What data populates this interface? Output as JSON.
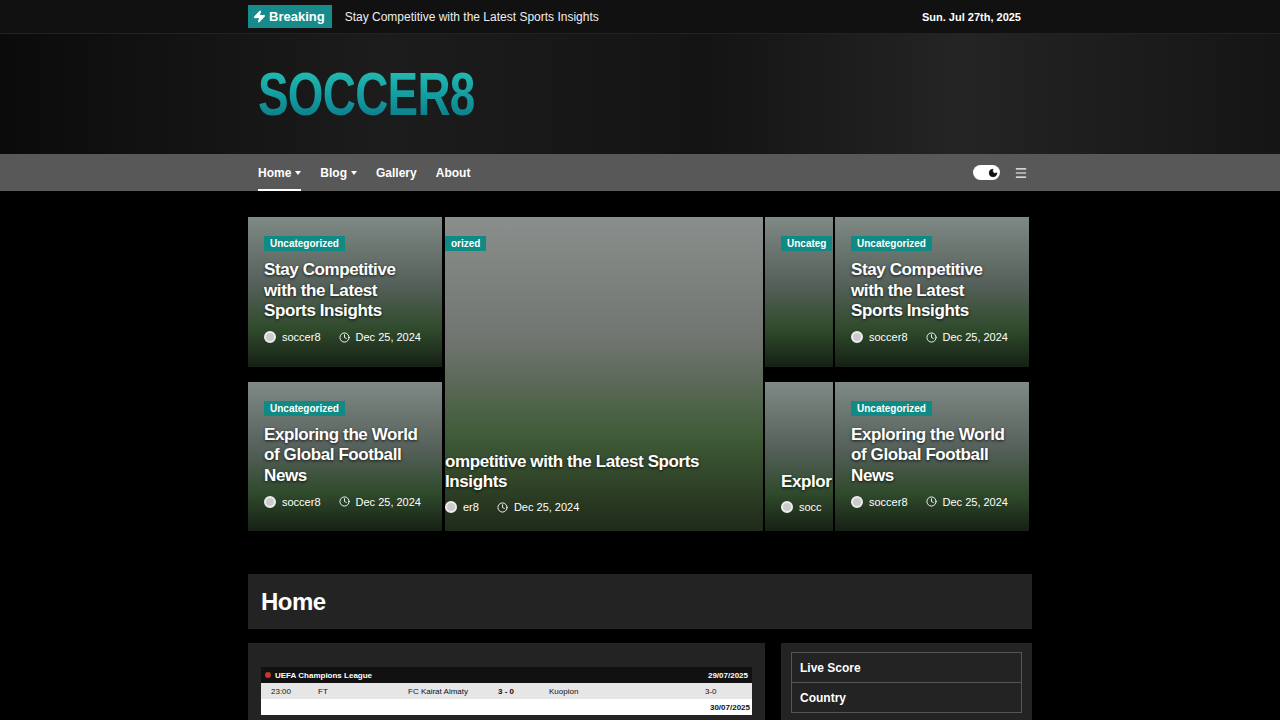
{
  "topbar": {
    "badge": "Breaking",
    "headline": "Stay Competitive with the Latest Sports Insights",
    "date": "Sun. Jul 27th, 2025"
  },
  "logo": "SOCCER8",
  "nav": [
    {
      "label": "Home",
      "selected": true,
      "dropdown": true
    },
    {
      "label": "Blog",
      "selected": false,
      "dropdown": true
    },
    {
      "label": "Gallery",
      "selected": false,
      "dropdown": false
    },
    {
      "label": "About",
      "selected": false,
      "dropdown": false
    }
  ],
  "theme_toggle": {
    "on": true
  },
  "slider": [
    {
      "kind": "side",
      "cards": [
        {
          "category": "Uncategorized",
          "title": "Stay Competitive with the Latest Sports Insights",
          "author": "soccer8",
          "date": "Dec 25, 2024"
        },
        {
          "category": "Uncategorized",
          "title": "Exploring the World of Global Football News",
          "author": "soccer8",
          "date": "Dec 25, 2024"
        }
      ]
    },
    {
      "kind": "main",
      "cards": [
        {
          "category": "orized",
          "title": "ompetitive with the Latest Sports Insights",
          "author": "er8",
          "date": "Dec 25, 2024"
        }
      ]
    },
    {
      "kind": "peek",
      "cards": [
        {
          "category": "Uncateg",
          "title": "",
          "author": "",
          "date": ""
        },
        {
          "category": "",
          "title": "Explor",
          "author": "socc",
          "date": ""
        }
      ]
    },
    {
      "kind": "side",
      "cards": [
        {
          "category": "Uncategorized",
          "title": "Stay Competitive with the Latest Sports Insights",
          "author": "soccer8",
          "date": "Dec 25, 2024"
        },
        {
          "category": "Uncategorized",
          "title": "Exploring the World of Global Football News",
          "author": "soccer8",
          "date": "Dec 25, 2024"
        }
      ]
    }
  ],
  "page_title": "Home",
  "scores": {
    "league": "UEFA Champions League",
    "date": "29/07/2025",
    "matches": [
      {
        "time": "23:00",
        "status": "FT",
        "home": "FC Kairat Almaty",
        "score": "3 - 0",
        "away": "Kuopion",
        "aggregate": "3-0"
      }
    ],
    "next_date": "30/07/2025"
  },
  "sidebar": [
    "Live Score",
    "Country"
  ]
}
